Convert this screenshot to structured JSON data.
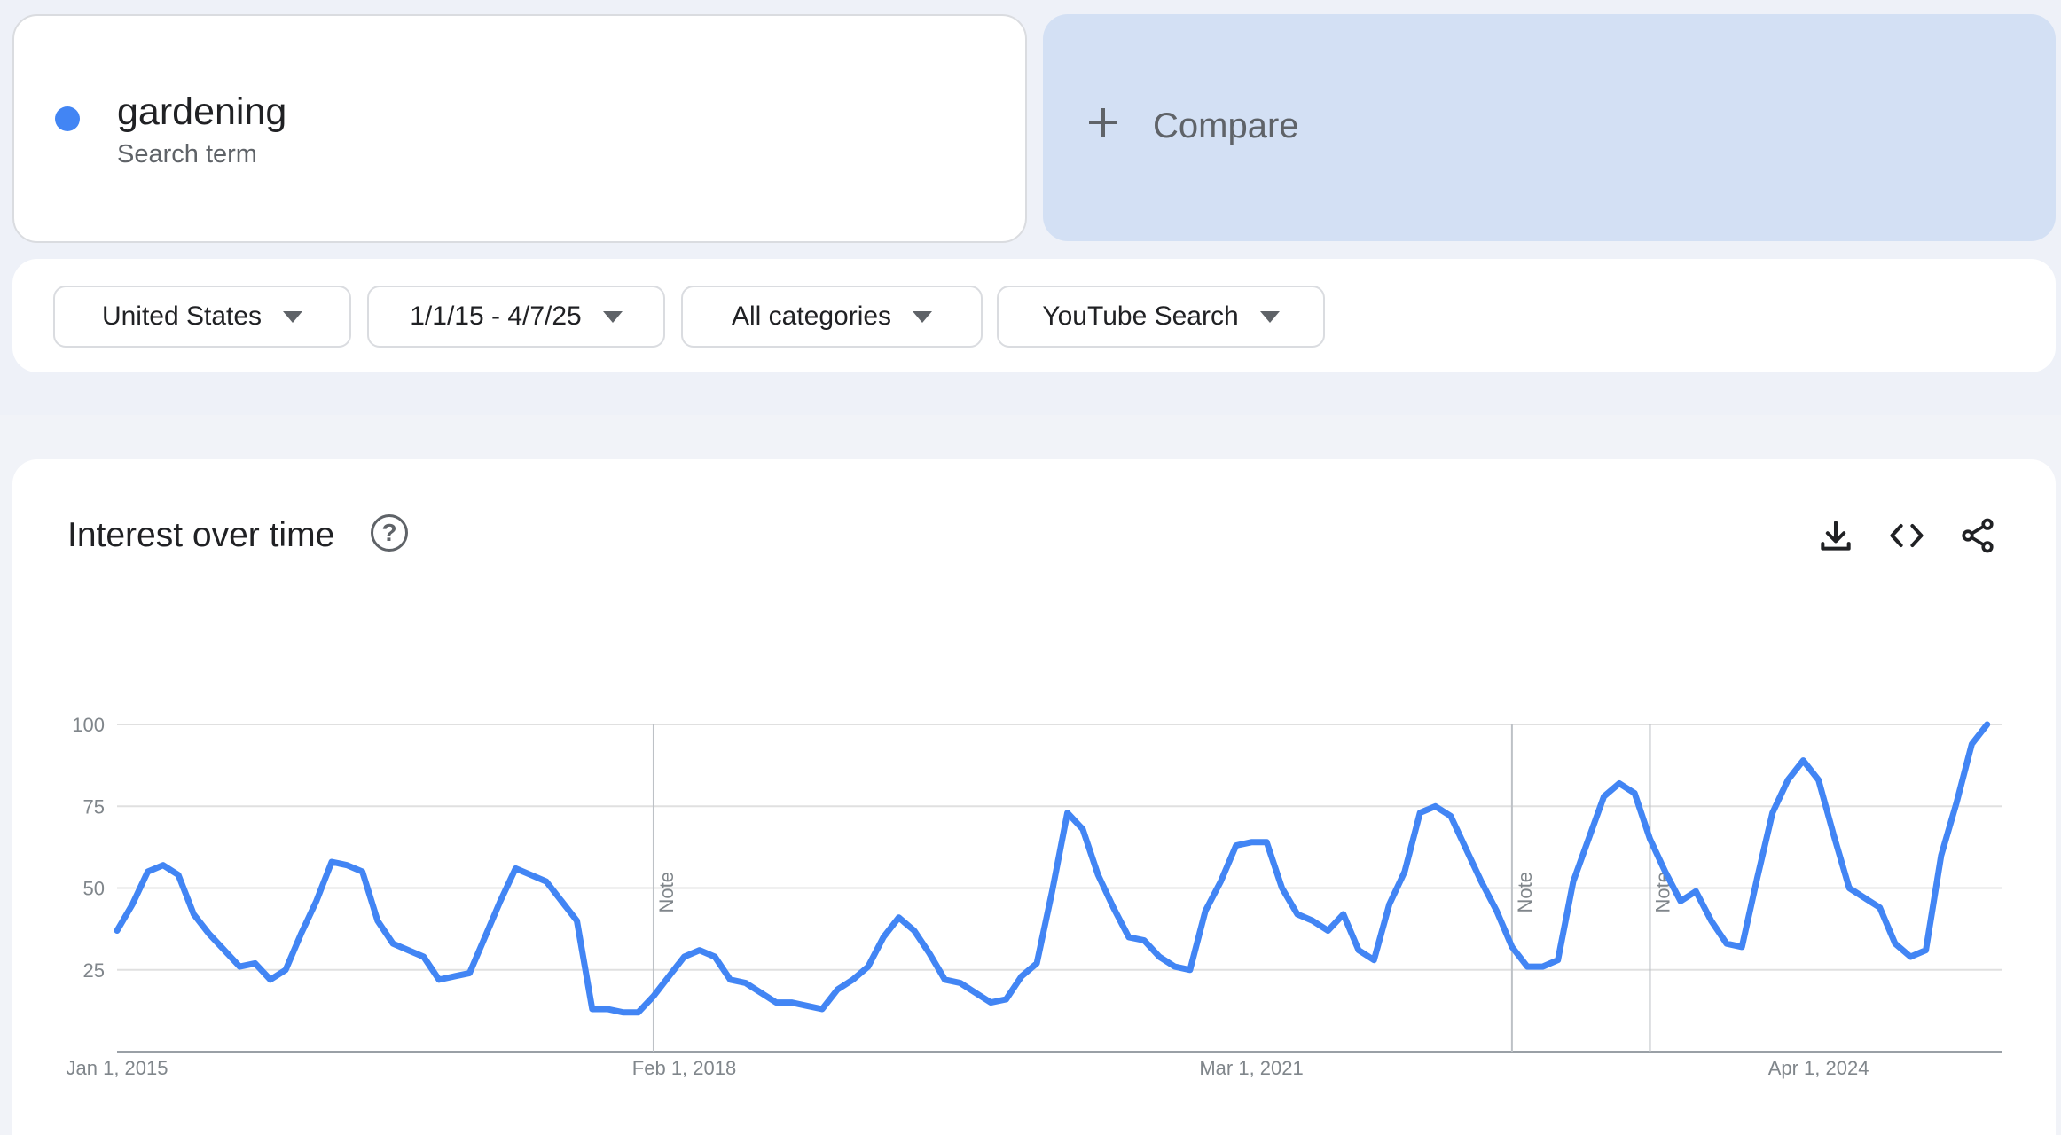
{
  "search_term": {
    "name": "gardening",
    "type": "Search term",
    "color": "#4285f4"
  },
  "compare": {
    "label": "Compare"
  },
  "filters": {
    "region": "United States",
    "date_range": "1/1/15 - 4/7/25",
    "category": "All categories",
    "property": "YouTube Search"
  },
  "chart_card": {
    "title": "Interest over time",
    "icons": [
      "help-icon",
      "download-icon",
      "embed-icon",
      "share-icon"
    ]
  },
  "chart_data": {
    "type": "line",
    "title": "Interest over time",
    "xlabel": "",
    "ylabel": "",
    "ylim": [
      0,
      100
    ],
    "yticks": [
      25,
      50,
      75,
      100
    ],
    "xticks": [
      "Jan 1, 2015",
      "Feb 1, 2018",
      "Mar 1, 2021",
      "Apr 1, 2024"
    ],
    "x_start": "2015-01-01",
    "x_end": "2025-04-01",
    "grid": true,
    "legend": "none",
    "line_color": "#4285f4",
    "notes": [
      {
        "date": "2017-12-01",
        "label": "Note"
      },
      {
        "date": "2022-08-01",
        "label": "Note"
      },
      {
        "date": "2023-05-01",
        "label": "Note"
      }
    ],
    "series": [
      {
        "name": "gardening",
        "points": [
          [
            "2015-01-01",
            37
          ],
          [
            "2015-02-01",
            45
          ],
          [
            "2015-03-01",
            55
          ],
          [
            "2015-04-01",
            57
          ],
          [
            "2015-05-01",
            54
          ],
          [
            "2015-06-01",
            42
          ],
          [
            "2015-07-01",
            36
          ],
          [
            "2015-08-01",
            31
          ],
          [
            "2015-09-01",
            26
          ],
          [
            "2015-10-01",
            27
          ],
          [
            "2015-11-01",
            22
          ],
          [
            "2015-12-01",
            25
          ],
          [
            "2016-01-01",
            36
          ],
          [
            "2016-02-01",
            46
          ],
          [
            "2016-03-01",
            58
          ],
          [
            "2016-04-01",
            57
          ],
          [
            "2016-05-01",
            55
          ],
          [
            "2016-06-01",
            40
          ],
          [
            "2016-07-01",
            33
          ],
          [
            "2016-08-01",
            31
          ],
          [
            "2016-09-01",
            29
          ],
          [
            "2016-10-01",
            22
          ],
          [
            "2016-11-01",
            23
          ],
          [
            "2016-12-01",
            24
          ],
          [
            "2017-01-01",
            35
          ],
          [
            "2017-02-01",
            46
          ],
          [
            "2017-03-01",
            56
          ],
          [
            "2017-04-01",
            54
          ],
          [
            "2017-05-01",
            52
          ],
          [
            "2017-06-01",
            46
          ],
          [
            "2017-07-01",
            40
          ],
          [
            "2017-08-01",
            13
          ],
          [
            "2017-09-01",
            13
          ],
          [
            "2017-10-01",
            12
          ],
          [
            "2017-11-01",
            12
          ],
          [
            "2017-12-01",
            17
          ],
          [
            "2018-01-01",
            23
          ],
          [
            "2018-02-01",
            29
          ],
          [
            "2018-03-01",
            31
          ],
          [
            "2018-04-01",
            29
          ],
          [
            "2018-05-01",
            22
          ],
          [
            "2018-06-01",
            21
          ],
          [
            "2018-07-01",
            18
          ],
          [
            "2018-08-01",
            15
          ],
          [
            "2018-09-01",
            15
          ],
          [
            "2018-10-01",
            14
          ],
          [
            "2018-11-01",
            13
          ],
          [
            "2018-12-01",
            19
          ],
          [
            "2019-01-01",
            22
          ],
          [
            "2019-02-01",
            26
          ],
          [
            "2019-03-01",
            35
          ],
          [
            "2019-04-01",
            41
          ],
          [
            "2019-05-01",
            37
          ],
          [
            "2019-06-01",
            30
          ],
          [
            "2019-07-01",
            22
          ],
          [
            "2019-08-01",
            21
          ],
          [
            "2019-09-01",
            18
          ],
          [
            "2019-10-01",
            15
          ],
          [
            "2019-11-01",
            16
          ],
          [
            "2019-12-01",
            23
          ],
          [
            "2020-01-01",
            27
          ],
          [
            "2020-02-01",
            49
          ],
          [
            "2020-03-01",
            73
          ],
          [
            "2020-04-01",
            68
          ],
          [
            "2020-05-01",
            54
          ],
          [
            "2020-06-01",
            44
          ],
          [
            "2020-07-01",
            35
          ],
          [
            "2020-08-01",
            34
          ],
          [
            "2020-09-01",
            29
          ],
          [
            "2020-10-01",
            26
          ],
          [
            "2020-11-01",
            25
          ],
          [
            "2020-12-01",
            43
          ],
          [
            "2021-01-01",
            52
          ],
          [
            "2021-02-01",
            63
          ],
          [
            "2021-03-01",
            64
          ],
          [
            "2021-04-01",
            64
          ],
          [
            "2021-05-01",
            50
          ],
          [
            "2021-06-01",
            42
          ],
          [
            "2021-07-01",
            40
          ],
          [
            "2021-08-01",
            37
          ],
          [
            "2021-09-01",
            42
          ],
          [
            "2021-10-01",
            31
          ],
          [
            "2021-11-01",
            28
          ],
          [
            "2021-12-01",
            45
          ],
          [
            "2022-01-01",
            55
          ],
          [
            "2022-02-01",
            73
          ],
          [
            "2022-03-01",
            75
          ],
          [
            "2022-04-01",
            72
          ],
          [
            "2022-05-01",
            62
          ],
          [
            "2022-06-01",
            52
          ],
          [
            "2022-07-01",
            43
          ],
          [
            "2022-08-01",
            32
          ],
          [
            "2022-09-01",
            26
          ],
          [
            "2022-10-01",
            26
          ],
          [
            "2022-11-01",
            28
          ],
          [
            "2022-12-01",
            52
          ],
          [
            "2023-01-01",
            65
          ],
          [
            "2023-02-01",
            78
          ],
          [
            "2023-03-01",
            82
          ],
          [
            "2023-04-01",
            79
          ],
          [
            "2023-05-01",
            65
          ],
          [
            "2023-06-01",
            55
          ],
          [
            "2023-07-01",
            46
          ],
          [
            "2023-08-01",
            49
          ],
          [
            "2023-09-01",
            40
          ],
          [
            "2023-10-01",
            33
          ],
          [
            "2023-11-01",
            32
          ],
          [
            "2023-12-01",
            53
          ],
          [
            "2024-01-01",
            73
          ],
          [
            "2024-02-01",
            83
          ],
          [
            "2024-03-01",
            89
          ],
          [
            "2024-04-01",
            83
          ],
          [
            "2024-05-01",
            66
          ],
          [
            "2024-06-01",
            50
          ],
          [
            "2024-07-01",
            47
          ],
          [
            "2024-08-01",
            44
          ],
          [
            "2024-09-01",
            33
          ],
          [
            "2024-10-01",
            29
          ],
          [
            "2024-11-01",
            31
          ],
          [
            "2024-12-01",
            60
          ],
          [
            "2025-01-01",
            76
          ],
          [
            "2025-02-01",
            94
          ],
          [
            "2025-03-01",
            100
          ]
        ]
      }
    ]
  }
}
